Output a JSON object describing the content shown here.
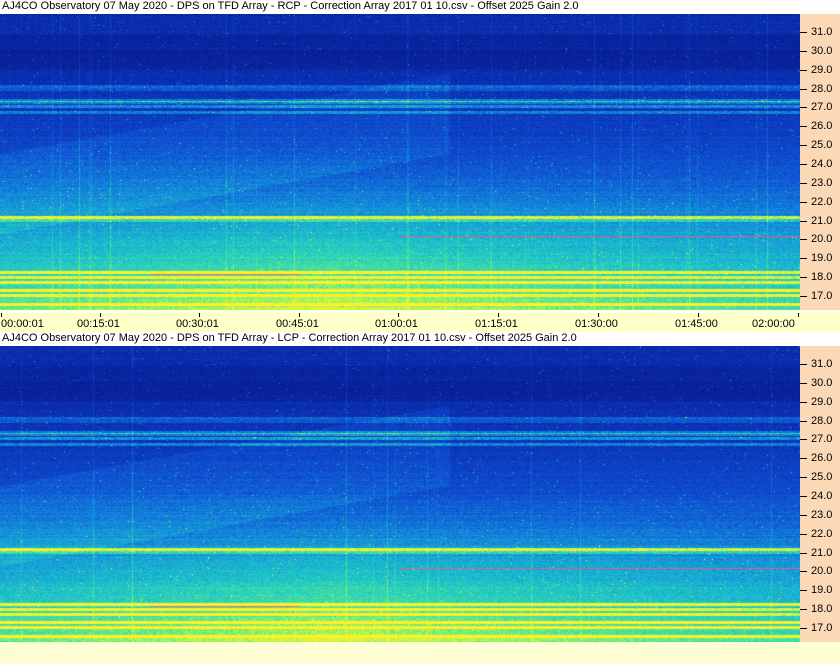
{
  "panels": [
    {
      "title": "AJ4CO Observatory 07 May 2020  -  DPS on TFD Array  -  RCP  -  Correction Array 2017 01 10.csv  -  Offset 2025  Gain 2.0",
      "freq_labels": [
        "31.0",
        "30.0",
        "29.0",
        "28.0",
        "27.0",
        "26.0",
        "25.0",
        "24.0",
        "23.0",
        "22.0",
        "21.0",
        "20.0",
        "19.0",
        "18.0",
        "17.0"
      ]
    },
    {
      "title": "AJ4CO Observatory 07 May 2020  -  DPS on TFD Array  -  LCP  -  Correction Array 2017 01 10.csv  -  Offset 2025  Gain 2.0",
      "freq_labels": [
        "31.0",
        "30.0",
        "29.0",
        "28.0",
        "27.0",
        "26.0",
        "25.0",
        "24.0",
        "23.0",
        "22.0",
        "21.0",
        "20.0",
        "19.0",
        "18.0",
        "17.0"
      ]
    }
  ],
  "time_axis": {
    "labels": [
      "00:00:01",
      "00:15:01",
      "00:30:01",
      "00:45:01",
      "01:00:01",
      "01:15:01",
      "01:30:00",
      "01:45:00",
      "02:00:00"
    ]
  },
  "colors": {
    "axis_background": "#fcd9b6",
    "time_axis_background": "#ffffc8",
    "spectrogram_low": "#0a1f8f",
    "spectrogram_high": "#c8ff3c"
  }
}
